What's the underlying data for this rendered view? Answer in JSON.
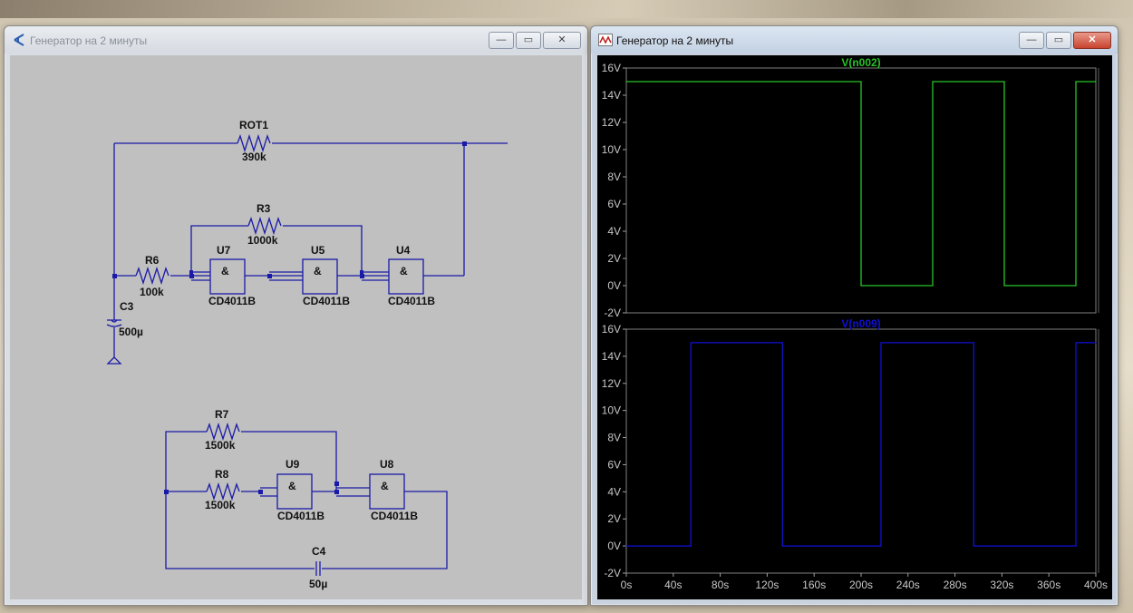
{
  "schematic_window": {
    "title": "Генератор на 2 минуты",
    "buttons": {
      "minimize": "—",
      "maximize": "▭",
      "close": "✕"
    },
    "components": {
      "rot1_name": "ROT1",
      "rot1_value": "390k",
      "r3_name": "R3",
      "r3_value": "1000k",
      "r6_name": "R6",
      "r6_value": "100k",
      "c3_name": "C3",
      "c3_value": "500µ",
      "u7_name": "U7",
      "u7_type": "CD4011B",
      "u5_name": "U5",
      "u5_type": "CD4011B",
      "u4_name": "U4",
      "u4_type": "CD4011B",
      "r7_name": "R7",
      "r7_value": "1500k",
      "r8_name": "R8",
      "r8_value": "1500k",
      "u9_name": "U9",
      "u9_type": "CD4011B",
      "u8_name": "U8",
      "u8_type": "CD4011B",
      "c4_name": "C4",
      "c4_value": "50µ",
      "gate_symbol": "&"
    }
  },
  "plot_window": {
    "title": "Генератор на 2 минуты",
    "buttons": {
      "minimize": "—",
      "maximize": "▭",
      "close": "✕"
    }
  },
  "chart_data": [
    {
      "type": "line",
      "title": "V(n002)",
      "color": "#27c427",
      "ylim": [
        -2,
        16
      ],
      "yticks": [
        "16V",
        "14V",
        "12V",
        "10V",
        "8V",
        "6V",
        "4V",
        "2V",
        "0V",
        "-2V"
      ],
      "xlim": [
        0,
        400
      ],
      "x": [
        0,
        200,
        200,
        261,
        261,
        322,
        322,
        383,
        383,
        400
      ],
      "y": [
        15,
        15,
        0,
        0,
        15,
        15,
        0,
        0,
        15,
        15
      ]
    },
    {
      "type": "line",
      "title": "V(n009)",
      "color": "#1010d8",
      "ylim": [
        -2,
        16
      ],
      "yticks": [
        "16V",
        "14V",
        "12V",
        "10V",
        "8V",
        "6V",
        "4V",
        "2V",
        "0V",
        "-2V"
      ],
      "xlim": [
        0,
        400
      ],
      "xticks": [
        "0s",
        "40s",
        "80s",
        "120s",
        "160s",
        "200s",
        "240s",
        "280s",
        "320s",
        "360s",
        "400s"
      ],
      "x": [
        0,
        55,
        55,
        133,
        133,
        217,
        217,
        296,
        296,
        383,
        383,
        400
      ],
      "y": [
        0,
        0,
        15,
        15,
        0,
        0,
        15,
        15,
        0,
        0,
        15,
        15
      ]
    }
  ]
}
